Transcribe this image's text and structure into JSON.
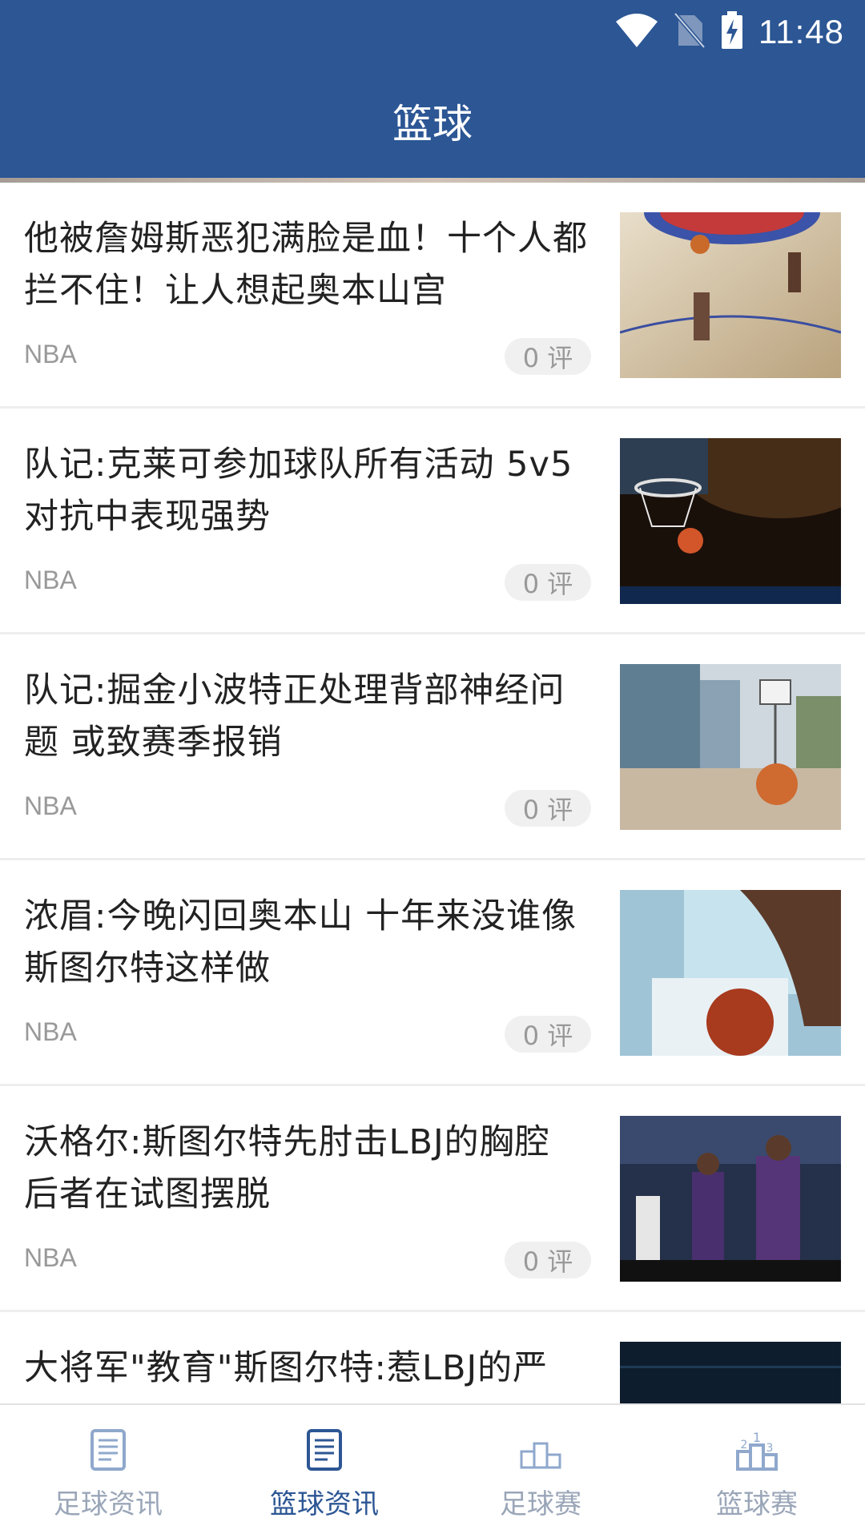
{
  "status_bar": {
    "time": "11:48",
    "icons": [
      "wifi-icon",
      "no-sim-icon",
      "battery-charging-icon"
    ]
  },
  "app_bar": {
    "title": "篮球"
  },
  "news": [
    {
      "title": "他被詹姆斯恶犯满脸是血！十个人都拦不住！让人想起奥本山宫",
      "source": "NBA",
      "comments": "0 评",
      "thumbnail": "basketball-court-game-photo"
    },
    {
      "title": "队记:克莱可参加球队所有活动 5v5对抗中表现强势",
      "source": "NBA",
      "comments": "0 评",
      "thumbnail": "hoop-ball-arena-photo"
    },
    {
      "title": "队记:掘金小波特正处理背部神经问题 或致赛季报销",
      "source": "NBA",
      "comments": "0 评",
      "thumbnail": "outdoor-court-ball-photo"
    },
    {
      "title": "浓眉:今晚闪回奥本山 十年来没谁像斯图尔特这样做",
      "source": "NBA",
      "comments": "0 评",
      "thumbnail": "player-holding-ball-photo"
    },
    {
      "title": "沃格尔:斯图尔特先肘击LBJ的胸腔 后者在试图摆脱",
      "source": "NBA",
      "comments": "0 评",
      "thumbnail": "lakers-players-photo"
    },
    {
      "title": "大将军\"教育\"斯图尔特:惹LBJ的严",
      "source": "",
      "comments": "",
      "thumbnail": "dark-arena-photo"
    }
  ],
  "bottom_nav": {
    "items": [
      {
        "label": "足球资讯",
        "icon": "article-icon",
        "active": false
      },
      {
        "label": "篮球资讯",
        "icon": "article-icon",
        "active": true
      },
      {
        "label": "足球赛",
        "icon": "podium-icon",
        "active": false
      },
      {
        "label": "篮球赛",
        "icon": "podium-ranked-icon",
        "active": false
      }
    ]
  },
  "colors": {
    "primary": "#2c5694",
    "nav_inactive": "#9aa6b8",
    "text": "#222222",
    "secondary_text": "#999999"
  }
}
